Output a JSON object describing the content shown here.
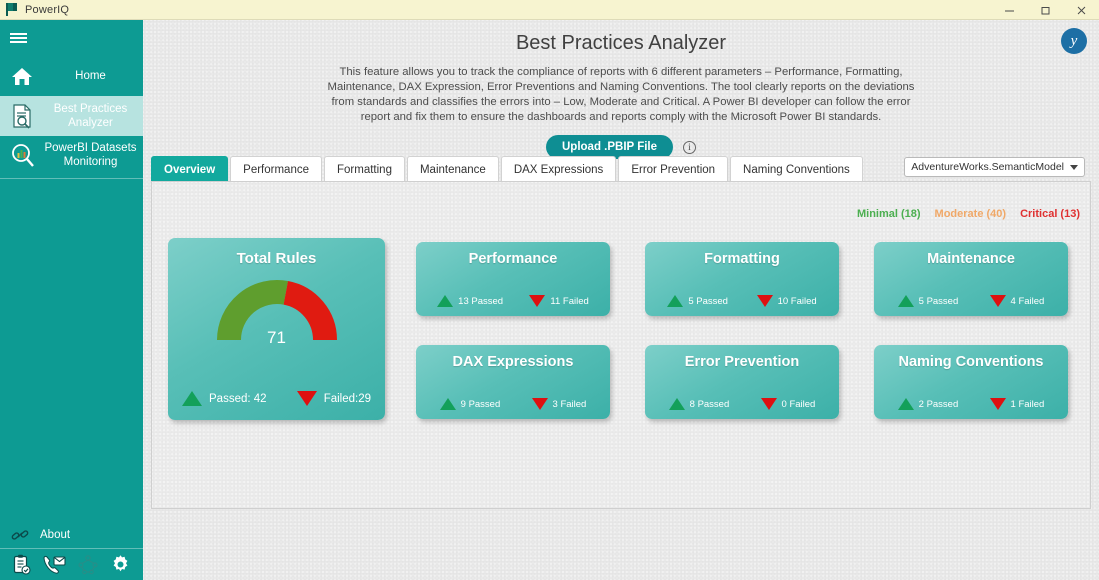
{
  "titlebar": {
    "app_name": "PowerIQ",
    "minimize": "–",
    "maximize": "❐",
    "close": "✕"
  },
  "sidebar": {
    "menu_icon": "hamburger-icon",
    "items": [
      {
        "label": "Home",
        "icon": "home-icon",
        "active": false
      },
      {
        "label": "Best Practices Analyzer",
        "icon": "document-search-icon",
        "active": true
      },
      {
        "label": "PowerBI Datasets Monitoring",
        "icon": "magnifier-chart-icon",
        "active": false
      }
    ],
    "about": {
      "label": "About",
      "icon": "link-icon"
    },
    "bottom_icons": [
      "clipboard-check-icon",
      "phone-mail-icon",
      "network-diagram-icon",
      "gear-icon"
    ]
  },
  "header": {
    "avatar_initial": "y",
    "title": "Best Practices Analyzer",
    "description": "This feature allows you to track the compliance of reports with 6 different parameters – Performance, Formatting, Maintenance, DAX Expression, Error Preventions and Naming Conventions. The tool clearly reports on the deviations from standards and classifies the errors into – Low, Moderate and Critical. A Power BI developer can follow the error report and fix them to ensure the dashboards and reports comply with the Microsoft Power BI standards.",
    "upload_button": "Upload .PBIP File",
    "info_icon": "info-icon"
  },
  "tabs": [
    {
      "label": "Overview",
      "active": true
    },
    {
      "label": "Performance",
      "active": false
    },
    {
      "label": "Formatting",
      "active": false
    },
    {
      "label": "Maintenance",
      "active": false
    },
    {
      "label": "DAX Expressions",
      "active": false
    },
    {
      "label": "Error Prevention",
      "active": false
    },
    {
      "label": "Naming Conventions",
      "active": false
    }
  ],
  "model_select": {
    "value": "AdventureWorks.SemanticModel",
    "caret_icon": "chevron-down-icon"
  },
  "legend": [
    {
      "label": "Minimal (18)",
      "color": "#4caf50"
    },
    {
      "label": "Moderate (40)",
      "color": "#f0a868"
    },
    {
      "label": "Critical (13)",
      "color": "#e03131"
    }
  ],
  "total_rules": {
    "title": "Total Rules",
    "gauge_value": "71",
    "passed_label": "Passed: 42",
    "failed_label": "Failed:29"
  },
  "cards": [
    {
      "title": "Performance",
      "passed": "13 Passed",
      "failed": "11 Failed"
    },
    {
      "title": "Formatting",
      "passed": "5 Passed",
      "failed": "10 Failed"
    },
    {
      "title": "Maintenance",
      "passed": "5 Passed",
      "failed": "4 Failed"
    },
    {
      "title": "DAX Expressions",
      "passed": "9 Passed",
      "failed": "3 Failed"
    },
    {
      "title": "Error Prevention",
      "passed": "8 Passed",
      "failed": "0 Failed"
    },
    {
      "title": "Naming Conventions",
      "passed": "2 Passed",
      "failed": "1 Failed"
    }
  ],
  "chart_data": {
    "type": "pie",
    "title": "Total Rules",
    "categories": [
      "Passed",
      "Failed"
    ],
    "values": [
      42,
      29
    ],
    "total": 71,
    "colors": [
      "#5f9e2e",
      "#e01b11"
    ],
    "shape": "half-donut-gauge",
    "center_label": "71"
  },
  "theme": {
    "brand_teal": "#0d9b93",
    "card_teal": "#53bdb5",
    "pass_green": "#13a05a",
    "fail_red": "#de1010",
    "titlebar_yellow": "#f7f4d0"
  }
}
